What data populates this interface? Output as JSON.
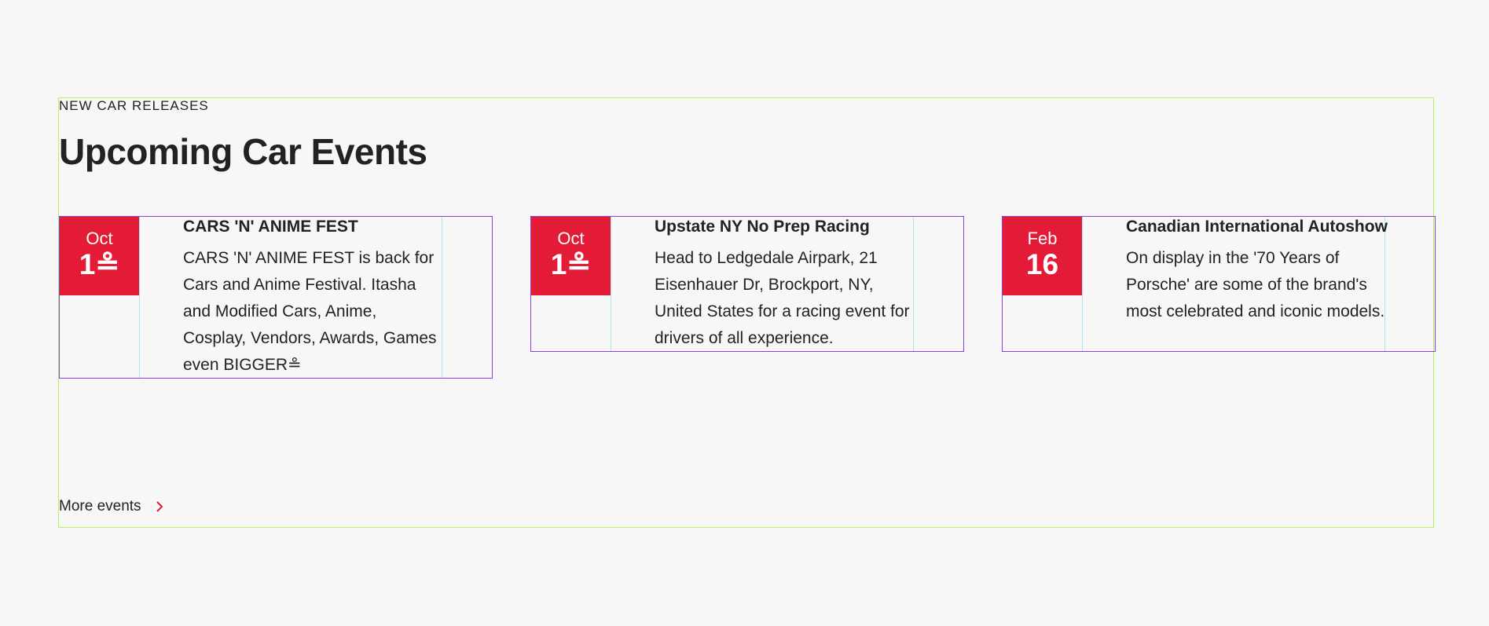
{
  "section": {
    "eyebrow": "NEW CAR RELEASES",
    "heading": "Upcoming Car Events",
    "more_label": "More events"
  },
  "events": [
    {
      "month": "Oct",
      "day": "1≗",
      "title": "CARS 'N' ANIME FEST",
      "description": "CARS 'N' ANIME FEST is back for Cars and Anime Festival. Itasha and Modified Cars, Anime, Cosplay, Vendors, Awards, Games even BIGGER≗"
    },
    {
      "month": "Oct",
      "day": "1≗",
      "title": "Upstate NY No Prep Racing",
      "description": "Head to Ledgedale Airpark, 21 Eisenhauer Dr, Brockport, NY, United States for a racing event for drivers of all experience."
    },
    {
      "month": "Feb",
      "day": "16",
      "title": "Canadian International Autoshow",
      "description": "On display in the '70 Years of Porsche' are some of the brand's most celebrated and iconic models."
    }
  ],
  "colors": {
    "accent": "#e31b36",
    "background": "#f7f7f7",
    "text": "#222222"
  },
  "icons": {
    "more": "chevron-right-icon"
  }
}
